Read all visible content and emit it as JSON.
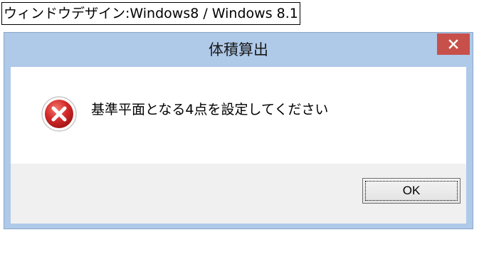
{
  "caption": {
    "text": "ウィンドウデザイン:Windows8 / Windows 8.1"
  },
  "window": {
    "title": "体積算出",
    "close_icon": "close-icon"
  },
  "message": {
    "icon": "error-icon",
    "text": "基準平面となる4点を設定してください"
  },
  "buttons": {
    "ok_label": "OK"
  },
  "colors": {
    "frame": "#afc9e8",
    "close_button": "#c7504a",
    "button_bar": "#f0f0f0",
    "error_red": "#d42a2a"
  }
}
